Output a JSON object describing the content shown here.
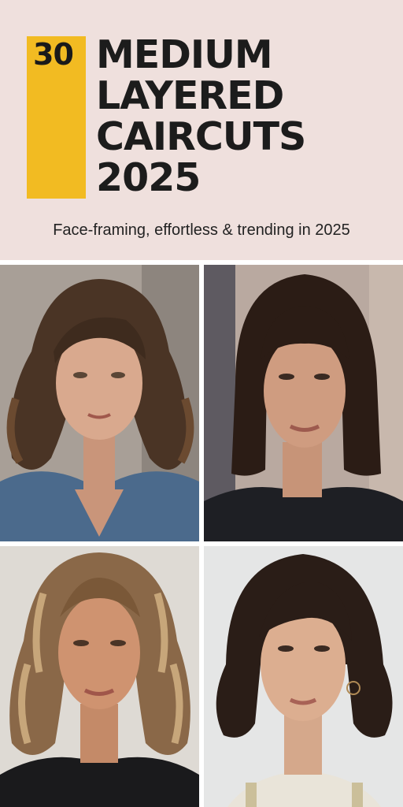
{
  "pin": {
    "count": "30",
    "title_lines": [
      "MEDIUM",
      "LAYERED",
      "CAIRCUTS",
      "2025"
    ],
    "subtitle": "Face-framing, effortless & trending in 2025"
  },
  "colors": {
    "header_bg": "#efe0dd",
    "accent": "#f2bb22",
    "text": "#1c1c1c"
  },
  "photos": [
    {
      "name": "wavy-shag-denim-jacket-photo"
    },
    {
      "name": "sleek-bob-with-bangs-photo"
    },
    {
      "name": "highlighted-layered-waves-photo"
    },
    {
      "name": "dark-curtain-layers-hoop-earring-photo"
    }
  ]
}
